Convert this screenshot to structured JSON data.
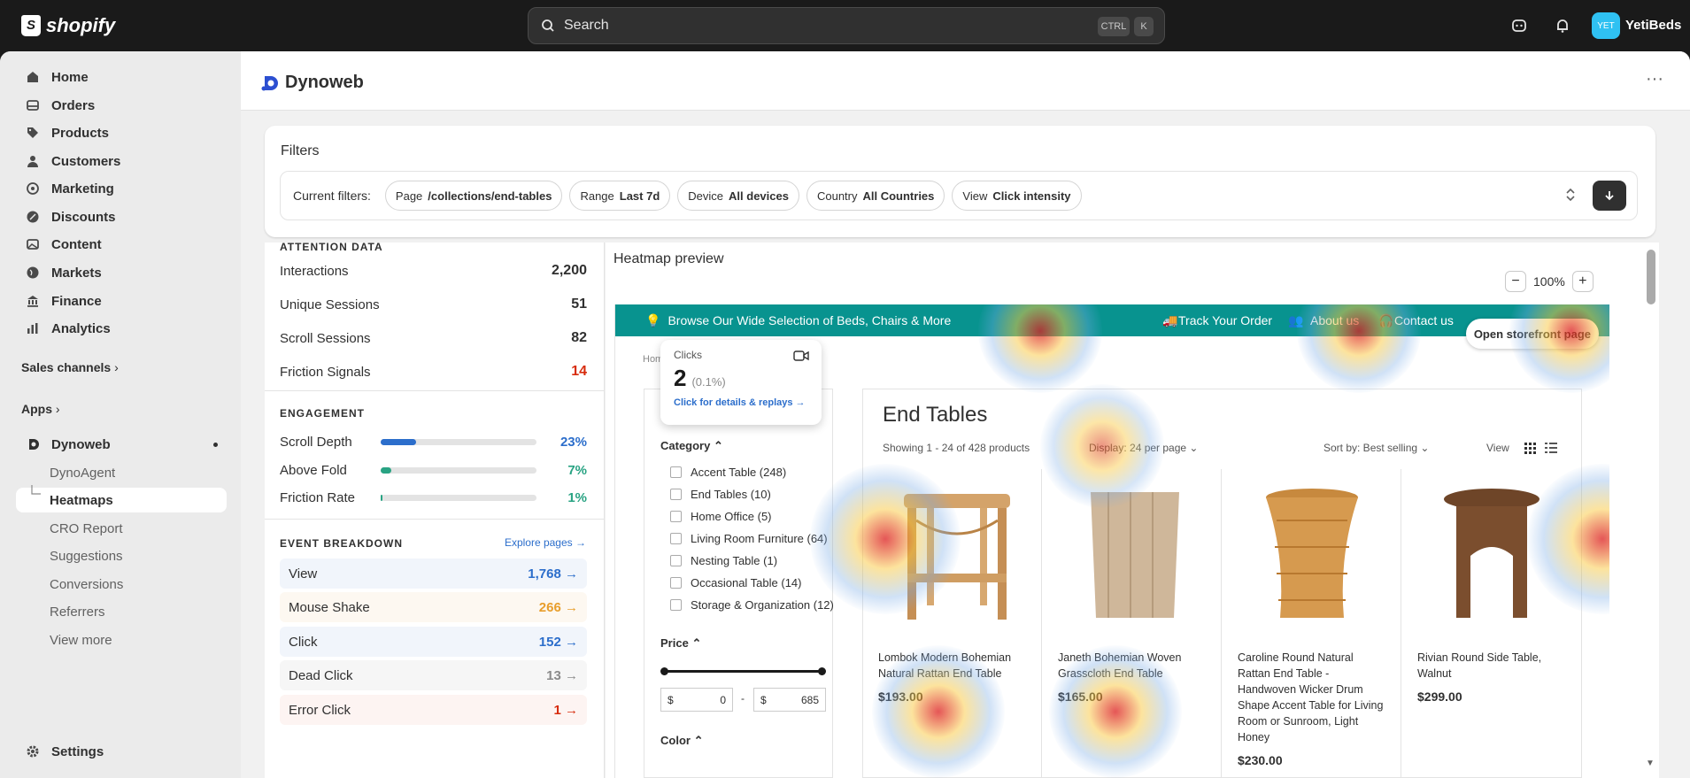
{
  "topbar": {
    "brand": "shopify",
    "search_placeholder": "Search",
    "shortcut_1": "CTRL",
    "shortcut_2": "K",
    "avatar_initials": "YET",
    "store_name": "YetiBeds"
  },
  "sidebar": {
    "items": [
      {
        "label": "Home",
        "icon": "home-icon"
      },
      {
        "label": "Orders",
        "icon": "inbox-icon"
      },
      {
        "label": "Products",
        "icon": "tag-icon"
      },
      {
        "label": "Customers",
        "icon": "person-icon"
      },
      {
        "label": "Marketing",
        "icon": "target-icon"
      },
      {
        "label": "Discounts",
        "icon": "discount-icon"
      },
      {
        "label": "Content",
        "icon": "image-icon"
      },
      {
        "label": "Markets",
        "icon": "globe-icon"
      },
      {
        "label": "Finance",
        "icon": "bank-icon"
      },
      {
        "label": "Analytics",
        "icon": "chart-icon"
      }
    ],
    "sales_channels": "Sales channels",
    "apps": "Apps",
    "app_name": "Dynoweb",
    "app_subitems": [
      "DynoAgent",
      "Heatmaps",
      "CRO Report",
      "Suggestions",
      "Conversions",
      "Referrers",
      "View more"
    ],
    "settings": "Settings"
  },
  "header": {
    "title": "Dynoweb"
  },
  "filters": {
    "title": "Filters",
    "current_label": "Current filters:",
    "chips": [
      {
        "key": "Page",
        "value": "/collections/end-tables"
      },
      {
        "key": "Range",
        "value": "Last 7d"
      },
      {
        "key": "Device",
        "value": "All devices"
      },
      {
        "key": "Country",
        "value": "All Countries"
      },
      {
        "key": "View",
        "value": "Click intensity"
      }
    ]
  },
  "attention": {
    "title": "ATTENTION DATA",
    "stats": [
      {
        "label": "Interactions",
        "value": "2,200"
      },
      {
        "label": "Unique Sessions",
        "value": "51"
      },
      {
        "label": "Scroll Sessions",
        "value": "82"
      },
      {
        "label": "Friction Signals",
        "value": "14"
      }
    ]
  },
  "engagement": {
    "title": "ENGAGEMENT",
    "rows": [
      {
        "label": "Scroll Depth",
        "pct": "23%",
        "level": 0.23,
        "color": "#2c6ecb"
      },
      {
        "label": "Above Fold",
        "pct": "7%",
        "level": 0.07,
        "color": "#29a383"
      },
      {
        "label": "Friction Rate",
        "pct": "1%",
        "level": 0.01,
        "color": "#29a383"
      }
    ]
  },
  "events": {
    "title": "EVENT BREAKDOWN",
    "link": "Explore pages →",
    "rows": [
      {
        "label": "View",
        "count": "1,768 →",
        "color": "#2c6ecb",
        "bg": "#f1f5fb"
      },
      {
        "label": "Mouse Shake",
        "count": "266 →",
        "color": "#e89e2c",
        "bg": "#fdf8f1"
      },
      {
        "label": "Click",
        "count": "152 →",
        "color": "#2c6ecb",
        "bg": "#f1f5fb"
      },
      {
        "label": "Dead Click",
        "count": "13 →",
        "color": "#8a8a8a",
        "bg": "#f6f6f6"
      },
      {
        "label": "Error Click",
        "count": "1 →",
        "color": "#d72c0d",
        "bg": "#fdf4f2"
      }
    ]
  },
  "heatmap": {
    "title": "Heatmap preview",
    "zoom": "100%",
    "open_store": "Open storefront page",
    "banner": "Browse Our Wide Selection of Beds, Chairs & More",
    "nav_links": [
      "Track Your Order",
      "About us",
      "Contact us"
    ],
    "breadcrumb": "Hom",
    "tooltip": {
      "label": "Clicks",
      "value": "2",
      "pct": "(0.1%)",
      "link": "Click for details & replays →"
    },
    "page_title": "End Tables",
    "showing": "Showing 1 - 24 of 428 products",
    "display": "Display: 24 per page",
    "sort": "Sort by: Best selling",
    "view": "View",
    "category_title": "Category",
    "categories": [
      "Accent Table (248)",
      "End Tables (10)",
      "Home Office (5)",
      "Living Room Furniture (64)",
      "Nesting Table (1)",
      "Occasional Table (14)",
      "Storage & Organization (12)"
    ],
    "price_title": "Price",
    "price_min": "0",
    "price_max": "685",
    "currency": "$",
    "color_title": "Color",
    "products": [
      {
        "name": "Lombok Modern Bohemian Natural Rattan End Table",
        "price": "$193.00"
      },
      {
        "name": "Janeth Bohemian Woven Grasscloth End Table",
        "price": "$165.00"
      },
      {
        "name": "Caroline Round Natural Rattan End Table - Handwoven Wicker Drum Shape Accent Table for Living Room or Sunroom, Light Honey",
        "price": "$230.00"
      },
      {
        "name": "Rivian Round Side Table, Walnut",
        "price": "$299.00"
      }
    ]
  }
}
